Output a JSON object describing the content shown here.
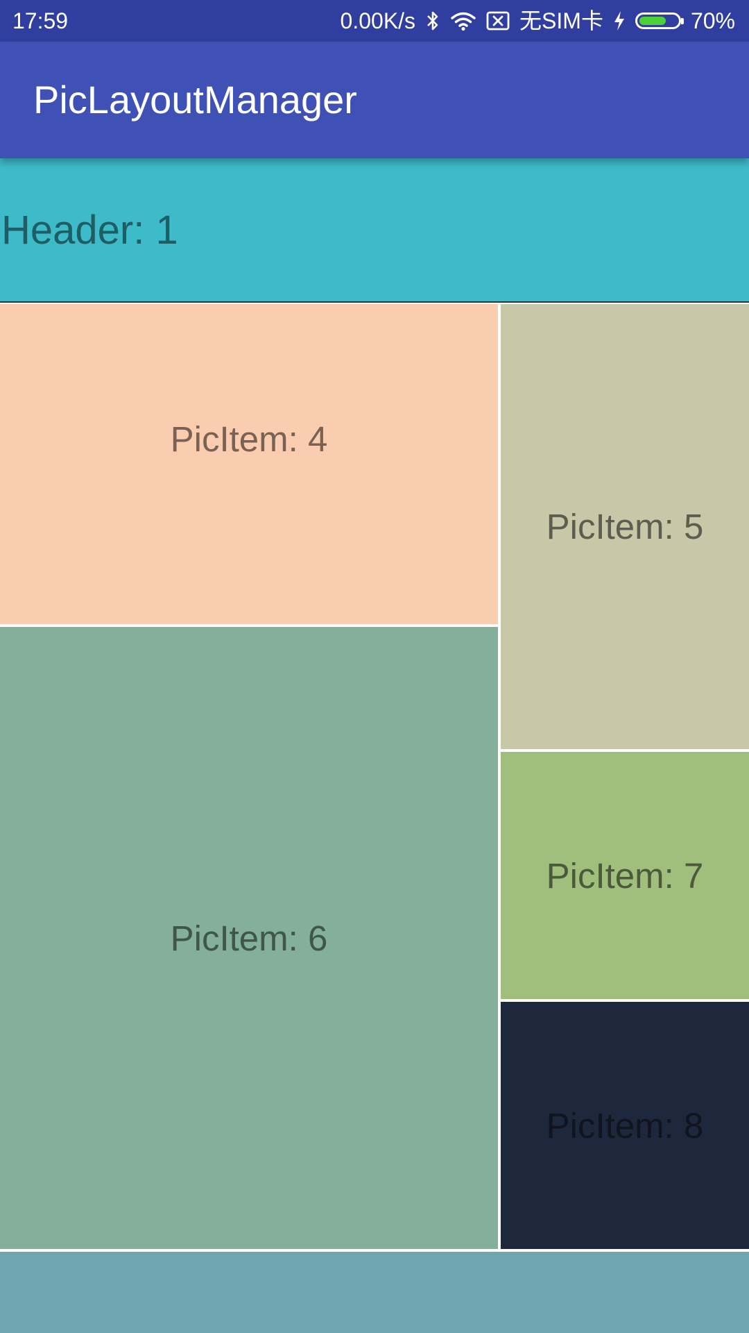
{
  "status_bar": {
    "time": "17:59",
    "network_speed": "0.00K/s",
    "sim_status": "无SIM卡",
    "battery_percent": "70%",
    "battery_level": 0.7,
    "icons": [
      "bluetooth-icon",
      "wifi-icon",
      "no-sim-icon",
      "charging-icon",
      "battery-icon"
    ]
  },
  "app_bar": {
    "title": "PicLayoutManager"
  },
  "header": {
    "label": "Header: 1",
    "color": "#3ebbc8"
  },
  "items": [
    {
      "label": "PicItem: 4",
      "color": "#fbcdb0"
    },
    {
      "label": "PicItem: 5",
      "color": "#c8c8a9"
    },
    {
      "label": "PicItem: 6",
      "color": "#83af9b"
    },
    {
      "label": "PicItem: 7",
      "color": "#a0bf7d"
    },
    {
      "label": "PicItem: 8",
      "color": "#1e283d"
    }
  ],
  "colors": {
    "status_bar": "#303f9f",
    "app_bar": "#3f51b5",
    "partial_bottom_tile": "#70a6b0"
  }
}
